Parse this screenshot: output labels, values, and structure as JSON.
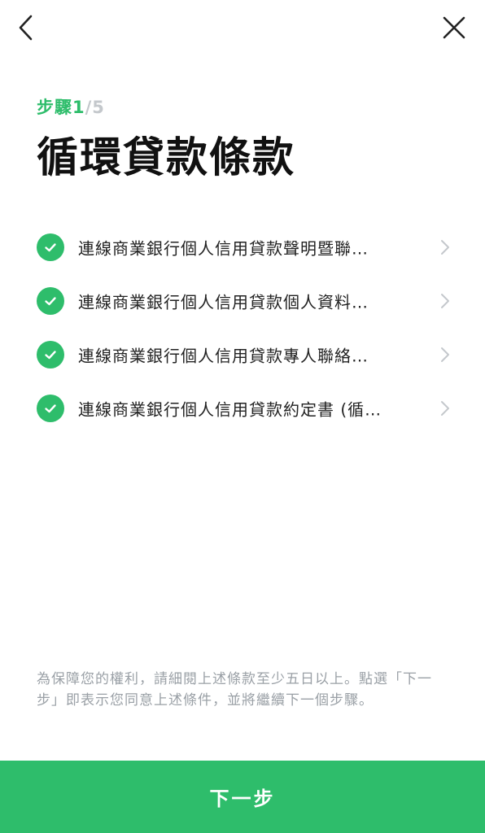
{
  "header": {
    "back_icon": "chevron-left-icon",
    "close_icon": "close-icon"
  },
  "step": {
    "word": "步驟",
    "current": "1",
    "total": "/5"
  },
  "title": "循環貸款條款",
  "terms": [
    {
      "label": "連線商業銀行個人信用貸款聲明暨聯…",
      "icon": "check-circle-icon"
    },
    {
      "label": "連線商業銀行個人信用貸款個人資料…",
      "icon": "check-circle-icon"
    },
    {
      "label": "連線商業銀行個人信用貸款專人聯絡…",
      "icon": "check-circle-icon"
    },
    {
      "label": "連線商業銀行個人信用貸款約定書 (循…",
      "icon": "check-circle-icon"
    }
  ],
  "notice": "為保障您的權利，請細閱上述條款至少五日以上。點選「下一步」即表示您同意上述條件，並將繼續下一個步驟。",
  "next_button": "下一步",
  "colors": {
    "accent": "#2ebd6b",
    "muted": "#c4c8cc",
    "text": "#111111",
    "notice": "#9aa0a6"
  }
}
